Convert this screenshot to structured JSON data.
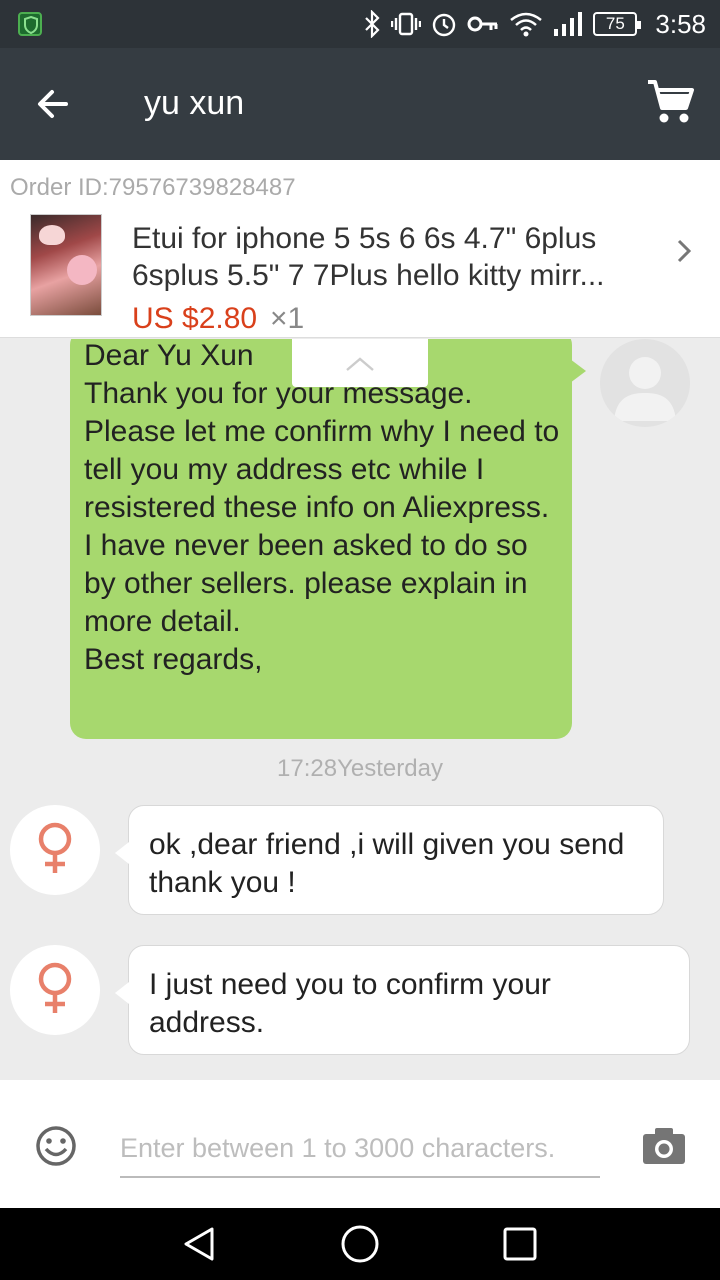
{
  "status_bar": {
    "battery": "75",
    "time": "3:58"
  },
  "header": {
    "title": "yu xun"
  },
  "order": {
    "id_label": "Order ID:79576739828487",
    "product_title": "Etui for iphone 5 5s 6 6s 4.7\" 6plus 6splus 5.5\" 7 7Plus hello kitty mirr...",
    "price": "US $2.80",
    "quantity": "×1",
    "price_color": "#d9401b"
  },
  "messages": [
    {
      "sender": "me",
      "text": "Dear Yu Xun\nThank you for your message.\nPlease let me confirm why I need to tell you my address etc while I resistered these info on Aliexpress.\nI have never been asked to do so by other sellers. please explain in more detail.\nBest regards,"
    },
    {
      "sender": "seller",
      "text": "ok ,dear friend ,i will given you send thank you !"
    },
    {
      "sender": "seller",
      "text": "I just need you to confirm your address."
    }
  ],
  "timestamp": "17:28Yesterday",
  "input": {
    "placeholder": "Enter between 1 to 3000 characters.",
    "value": ""
  },
  "icons": {
    "status": [
      "shield-icon",
      "bluetooth-icon",
      "vibrate-icon",
      "alarm-icon",
      "key-icon",
      "wifi-icon",
      "signal-icon",
      "battery-icon"
    ],
    "header": [
      "back-arrow-icon",
      "cart-icon"
    ],
    "avatar": [
      "female-symbol-icon",
      "person-silhouette-icon"
    ],
    "input": [
      "emoji-icon",
      "camera-icon"
    ],
    "nav": [
      "back-triangle-icon",
      "home-circle-icon",
      "recents-square-icon"
    ]
  },
  "colors": {
    "header_bg": "#353c42",
    "my_bubble": "#a7d86e",
    "seller_bubble": "#ffffff",
    "female_symbol": "#e8806a"
  }
}
